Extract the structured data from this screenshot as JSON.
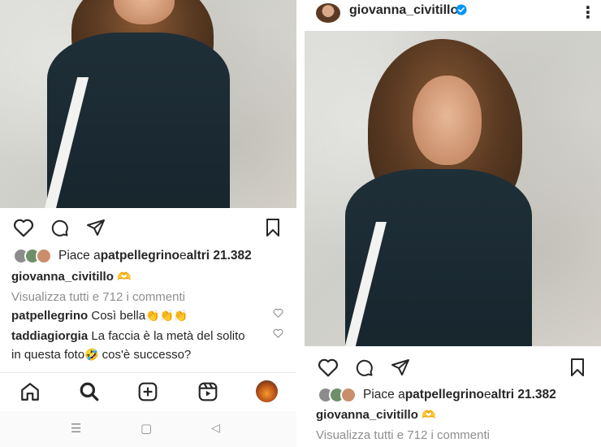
{
  "left": {
    "likes": {
      "prefix": "Piace a ",
      "user": "patpellegrino",
      "middle": " e ",
      "rest": "altri 21.382"
    },
    "caption": {
      "user": "giovanna_civitillo",
      "emoji": "🫶"
    },
    "view_comments": "Visualizza tutti e 712 i commenti",
    "comments": [
      {
        "user": "patpellegrino",
        "text": " Così bella",
        "emoji": "👏👏👏"
      },
      {
        "user": "taddiagiorgia",
        "text": " La faccia è la metà del solito",
        "text2": "in questa foto",
        "emoji": "🤣",
        "text3": " cos'è successo?"
      }
    ]
  },
  "right": {
    "header": {
      "username": "giovanna_civitillo",
      "more": "⋮"
    },
    "likes": {
      "prefix": "Piace a ",
      "user": "patpellegrino",
      "middle": " e ",
      "rest": "altri 21.382"
    },
    "caption": {
      "user": "giovanna_civitillo",
      "emoji": "🫶"
    },
    "view_comments": "Visualizza tutti e 712 i commenti"
  },
  "colors": {
    "text": "#262626",
    "muted": "#8e8e8e",
    "verified": "#0095f6",
    "sweater": "#1f2f38"
  },
  "icons": [
    "heart-icon",
    "comment-icon",
    "share-icon",
    "bookmark-icon",
    "home-icon",
    "search-icon",
    "add-icon",
    "reels-icon",
    "profile-avatar",
    "verified-icon",
    "more-icon",
    "android-menu-icon",
    "android-home-icon",
    "android-back-icon"
  ],
  "android_nav": {
    "menu": "☰",
    "home": "▢",
    "back": "◁"
  }
}
